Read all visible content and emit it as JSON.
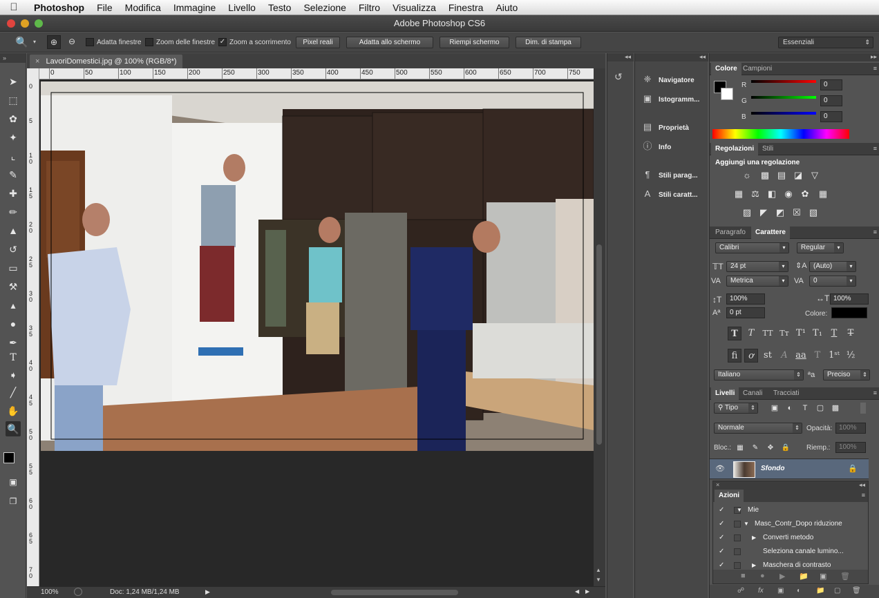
{
  "menubar": {
    "app": "Photoshop",
    "items": [
      "File",
      "Modifica",
      "Immagine",
      "Livello",
      "Testo",
      "Selezione",
      "Filtro",
      "Visualizza",
      "Finestra",
      "Aiuto"
    ]
  },
  "window": {
    "title": "Adobe Photoshop CS6"
  },
  "options": {
    "adatta_finestre": "Adatta finestre",
    "zoom_finestre": "Zoom delle finestre",
    "zoom_scorrimento": "Zoom a scorrimento",
    "zoom_scorrimento_checked": "✓",
    "pixel_reali": "Pixel reali",
    "adatta_schermo": "Adatta allo schermo",
    "riempi_schermo": "Riempi schermo",
    "dim_stampa": "Dim. di stampa",
    "workspace": "Essenziali"
  },
  "document": {
    "tab": "LavoriDomestici.jpg @ 100% (RGB/8*)",
    "ruler_h": [
      "0",
      "50",
      "100",
      "150",
      "200",
      "250",
      "300",
      "350",
      "400",
      "450",
      "500",
      "550",
      "600",
      "650",
      "700",
      "750"
    ],
    "ruler_v": [
      "0",
      "5",
      "1 0",
      "1 5",
      "2 0",
      "2 5",
      "3 0",
      "3 5",
      "4 0",
      "4 5",
      "5 0",
      "5 5",
      "6 0",
      "6 5",
      "7 0"
    ],
    "zoom": "100%",
    "doc_info": "Doc: 1,24 MB/1,24 MB"
  },
  "dock": {
    "navigatore": "Navigatore",
    "istogramma": "Istogramm...",
    "proprieta": "Proprietà",
    "info": "Info",
    "stili_parag": "Stili parag...",
    "stili_caratt": "Stili caratt..."
  },
  "color_panel": {
    "tab_active": "Colore",
    "tab_other": "Campioni",
    "r_label": "R",
    "g_label": "G",
    "b_label": "B",
    "r": "0",
    "g": "0",
    "b": "0",
    "fg_color": "#000000",
    "bg_color": "#ffffff"
  },
  "adjust_panel": {
    "tab_active": "Regolazioni",
    "tab_other": "Stili",
    "heading": "Aggiungi una regolazione"
  },
  "char_panel": {
    "tab_other": "Paragrafo",
    "tab_active": "Carattere",
    "font": "Calibri",
    "style": "Regular",
    "size": "24 pt",
    "leading": "(Auto)",
    "kerning": "Metrica",
    "tracking": "0",
    "v_scale": "100%",
    "h_scale": "100%",
    "baseline": "0 pt",
    "color_label": "Colore:",
    "language": "Italiano",
    "aa_label": "ªa",
    "antialias": "Preciso"
  },
  "layers_panel": {
    "tab_active": "Livelli",
    "tab2": "Canali",
    "tab3": "Tracciati",
    "kind": "Tipo",
    "blend": "Normale",
    "opacity_label": "Opacità:",
    "opacity": "100%",
    "lock_label": "Bloc.:",
    "fill_label": "Riemp.:",
    "fill": "100%",
    "layer_name": "Sfondo"
  },
  "actions_panel": {
    "title": "Azioni",
    "rows": [
      {
        "check": "✓",
        "toggle": "▼",
        "name": "Mie"
      },
      {
        "check": "✓",
        "toggle": "▼",
        "name": "Masc_Contr_Dopo riduzione"
      },
      {
        "check": "✓",
        "toggle": "▶",
        "name": "Converti metodo"
      },
      {
        "check": "✓",
        "toggle": "",
        "name": "Seleziona canale lumino..."
      },
      {
        "check": "✓",
        "toggle": "▶",
        "name": "Maschera di contrasto"
      }
    ]
  }
}
